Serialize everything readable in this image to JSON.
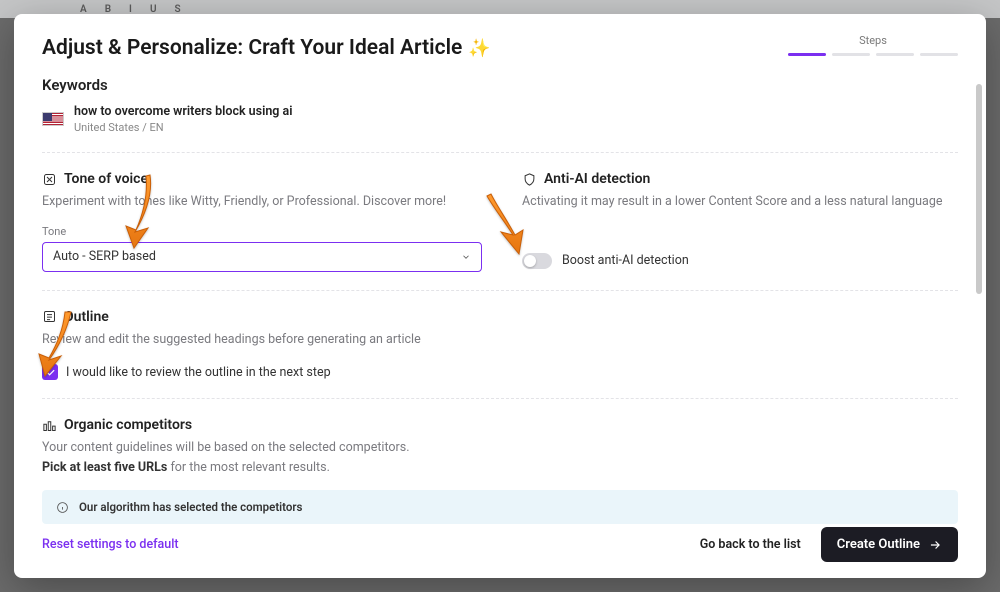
{
  "header": {
    "title": "Adjust & Personalize: Craft Your Ideal Article",
    "steps_label": "Steps"
  },
  "keywords": {
    "label": "Keywords",
    "query": "how to overcome writers block using ai",
    "locale": "United States / EN"
  },
  "tone": {
    "heading": "Tone of voice",
    "desc": "Experiment with tones like Witty, Friendly, or Professional. Discover more!",
    "field_label": "Tone",
    "selected": "Auto - SERP based"
  },
  "antiAi": {
    "heading": "Anti-AI detection",
    "desc": "Activating it may result in a lower Content Score and a less natural language",
    "toggle_label": "Boost anti-AI detection"
  },
  "outline": {
    "heading": "Outline",
    "desc": "Review and edit the suggested headings before generating an article",
    "checkbox_label": "I would like to review the outline in the next step"
  },
  "competitors": {
    "heading": "Organic competitors",
    "desc_1": "Your content guidelines will be based on the selected competitors.",
    "desc_2a": "Pick at least five URLs",
    "desc_2b": " for the most relevant results.",
    "banner": "Our algorithm has selected the competitors"
  },
  "footer": {
    "reset": "Reset settings to default",
    "back": "Go back to the list",
    "cta": "Create Outline"
  }
}
